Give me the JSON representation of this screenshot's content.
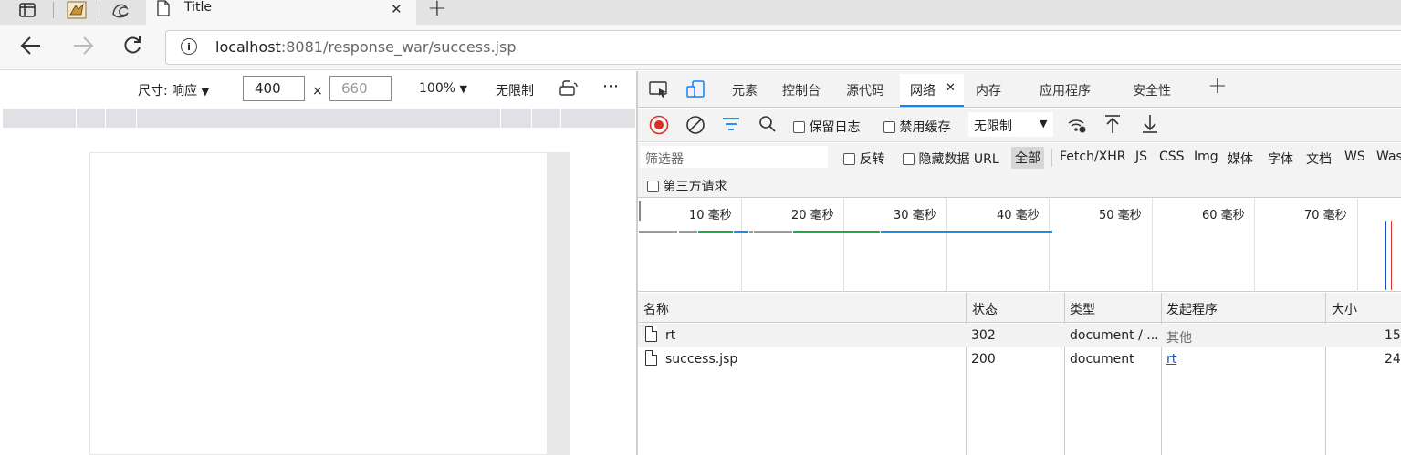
{
  "browser": {
    "tab_title": "Title",
    "url_host": "localhost",
    "url_rest": ":8081/response_war/success.jsp",
    "new_tab_symbol": "+"
  },
  "device_toolbar": {
    "size_label": "尺寸: 响应",
    "width": "400",
    "height": "660",
    "times": "×",
    "zoom": "100%",
    "throttle": "无限制",
    "more": "⋯"
  },
  "devtools": {
    "tabs": [
      "元素",
      "控制台",
      "源代码",
      "网络",
      "内存",
      "应用程序",
      "安全性"
    ],
    "active_tab": "网络",
    "close_symbol": "✕",
    "add_symbol": "+",
    "toolbar": {
      "preserve_log": "保留日志",
      "disable_cache": "禁用缓存",
      "throttle": "无限制"
    },
    "filter": {
      "placeholder": "筛选器",
      "invert": "反转",
      "hide_data_urls": "隐藏数据 URL",
      "types": [
        "全部",
        "Fetch/XHR",
        "JS",
        "CSS",
        "Img",
        "媒体",
        "字体",
        "文档",
        "WS",
        "Was"
      ],
      "third_party": "第三方请求"
    },
    "timeline": {
      "ticks": [
        "10 毫秒",
        "20 毫秒",
        "30 毫秒",
        "40 毫秒",
        "50 毫秒",
        "60 毫秒",
        "70 毫秒"
      ]
    },
    "table": {
      "headers": [
        "名称",
        "状态",
        "类型",
        "发起程序",
        "大小"
      ],
      "rows": [
        {
          "name": "rt",
          "status": "302",
          "type": "document / ...",
          "initiator": "其他",
          "size": "15"
        },
        {
          "name": "success.jsp",
          "status": "200",
          "type": "document",
          "initiator": "rt",
          "size": "24"
        }
      ]
    }
  },
  "colors": {
    "accent": "#0a84ff",
    "record_red": "#d93025",
    "link": "#1a55c6",
    "bar_green": "#1eaa4a",
    "bar_blue": "#1a8fe0",
    "bar_gray": "#9a9a9a"
  }
}
